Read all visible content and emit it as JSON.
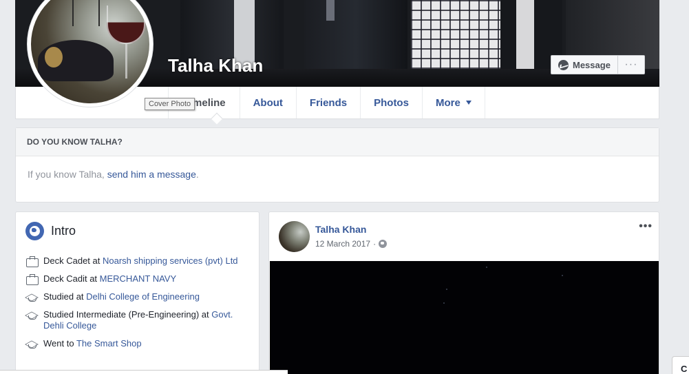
{
  "profile": {
    "name": "Talha Khan",
    "cover_tooltip": "Cover Photo"
  },
  "cover_actions": {
    "message_label": "Message",
    "more_label": "···"
  },
  "tabs": [
    {
      "label": "Timeline"
    },
    {
      "label": "About"
    },
    {
      "label": "Friends"
    },
    {
      "label": "Photos"
    },
    {
      "label": "More"
    }
  ],
  "know_box": {
    "heading": "DO YOU KNOW TALHA?",
    "text_before": "If you know Talha, ",
    "link": "send him a message",
    "text_after": "."
  },
  "intro": {
    "title": "Intro",
    "items": [
      {
        "icon": "briefcase-icon",
        "prefix": "Deck Cadet at ",
        "link": "Noarsh shipping services (pvt) Ltd"
      },
      {
        "icon": "briefcase-icon",
        "prefix": "Deck Cadit at ",
        "link": "MERCHANT NAVY"
      },
      {
        "icon": "graduation-cap-icon",
        "prefix": "Studied at ",
        "link": "Delhi College of Engineering"
      },
      {
        "icon": "graduation-cap-icon",
        "prefix": "Studied Intermediate (Pre-Engineering) at ",
        "link": "Govt. Dehli College"
      },
      {
        "icon": "graduation-cap-icon",
        "prefix": "Went to ",
        "link": "The Smart Shop"
      }
    ]
  },
  "post": {
    "author": "Talha Khan",
    "date": "12 March 2017",
    "separator": "·",
    "menu": "•••"
  },
  "chat": {
    "label": "C"
  },
  "colors": {
    "link": "#365899",
    "background": "#e9ebee",
    "accent": "#4267b2"
  }
}
